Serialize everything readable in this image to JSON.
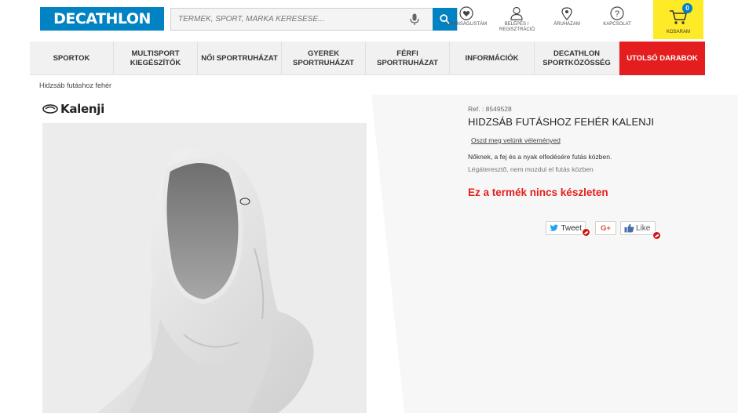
{
  "header": {
    "logo": "DECATHLON",
    "search_placeholder": "TERMÉK, SPORT, MÁRKA KERESÉSE...",
    "icons": [
      {
        "icon": "heart-icon",
        "label": "KÍVÁNSÁGLISTÁM"
      },
      {
        "icon": "user-icon",
        "label": "BELÉPÉS / REGISZTRÁCIÓ"
      },
      {
        "icon": "location-pin-icon",
        "label": "ÁRUHÁZAM"
      },
      {
        "icon": "help-icon",
        "label": "KAPCSOLAT"
      }
    ],
    "cart": {
      "label": "KOSARAM",
      "count": "0"
    }
  },
  "nav": {
    "items": [
      {
        "label": "SPORTOK"
      },
      {
        "label": "MULTISPORT KIEGÉSZÍTŐK"
      },
      {
        "label": "NŐI SPORTRUHÁZAT"
      },
      {
        "label": "GYEREK SPORTRUHÁZAT"
      },
      {
        "label": "FÉRFI SPORTRUHÁZAT"
      },
      {
        "label": "INFORMÁCIÓK"
      },
      {
        "label": "DECATHLON SPORTKÖZÖSSÉG"
      },
      {
        "label": "UTOLSÓ DARABOK"
      }
    ]
  },
  "breadcrumb": "Hidzsáb futáshoz fehér",
  "brand": {
    "name": "Kalenji"
  },
  "product": {
    "ref": "Ref. : 8549528",
    "title": "HIDZSÁB FUTÁSHOZ FEHÉR KALENJI",
    "review_link": "Oszd meg velünk véleményed",
    "desc1": "Nőknek, a fej és a nyak elfedésére futás közben.",
    "desc2": "Légáteresztő, nem mozdul el futás közben",
    "stock_status": "Ez a termék nincs készleten"
  },
  "social": {
    "tweet": "Tweet",
    "gplus": "G+",
    "like": "Like"
  },
  "colors": {
    "brand_blue": "#0082c3",
    "cart_yellow": "#ffea28",
    "alert_red": "#e41e1e"
  }
}
